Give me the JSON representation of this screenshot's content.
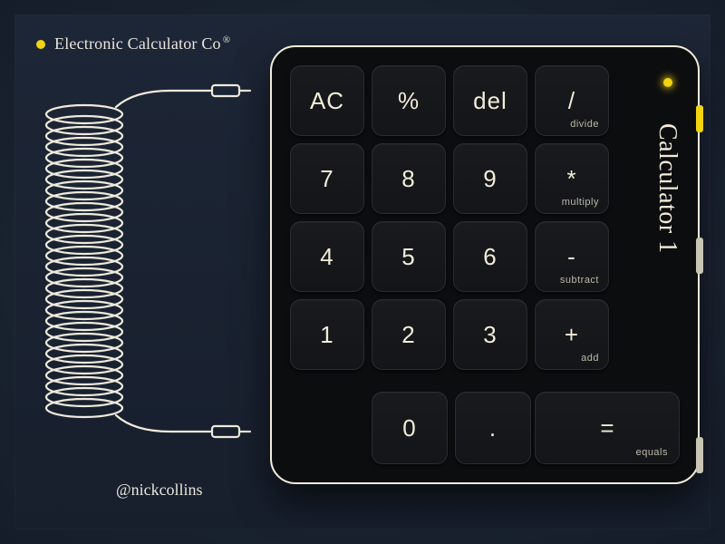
{
  "brand": {
    "name": "Electronic Calculator Co",
    "registered": "®"
  },
  "credit": "@nickcollins",
  "device": {
    "name": "Calculator 1",
    "keys": {
      "ac": "AC",
      "percent": "%",
      "del": "del",
      "divide": "/",
      "divide_sub": "divide",
      "7": "7",
      "8": "8",
      "9": "9",
      "multiply": "*",
      "multiply_sub": "multiply",
      "4": "4",
      "5": "5",
      "6": "6",
      "subtract": "-",
      "subtract_sub": "subtract",
      "1": "1",
      "2": "2",
      "3": "3",
      "add": "+",
      "add_sub": "add",
      "0": "0",
      "dot": ".",
      "equals": "=",
      "equals_sub": "equals"
    }
  },
  "colors": {
    "accent": "#f3d40e",
    "ink": "#f1ecd9",
    "device": "#0c0d0f"
  }
}
